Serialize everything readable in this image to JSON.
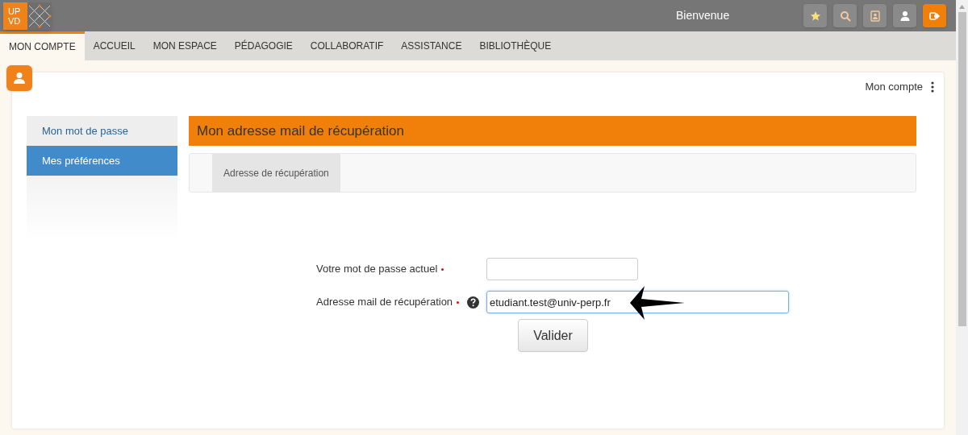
{
  "logo": {
    "line_1": "UP",
    "line_2": "VD"
  },
  "header": {
    "title": "Bienvenue"
  },
  "toolbar": [
    {
      "kind": "star"
    },
    {
      "kind": "search"
    },
    {
      "kind": "contacts"
    },
    {
      "kind": "user"
    },
    {
      "kind": "logout"
    }
  ],
  "tabs": [
    {
      "label": "MON COMPTE",
      "selected": true
    },
    {
      "label": "ACCUEIL",
      "selected": false
    },
    {
      "label": "MON ESPACE",
      "selected": false
    },
    {
      "label": "PÉDAGOGIE",
      "selected": false
    },
    {
      "label": "COLLABORATIF",
      "selected": false
    },
    {
      "label": "ASSISTANCE",
      "selected": false
    },
    {
      "label": "BIBLIOTHÈQUE",
      "selected": false
    }
  ],
  "breadcrumb": "Mon compte",
  "sidebar": {
    "items": [
      {
        "label": "Mon mot de passe",
        "selected": false
      },
      {
        "label": "Mes préférences",
        "selected": true
      }
    ]
  },
  "panel": {
    "title": "Mon adresse mail de récupération",
    "subtabs": [
      {
        "label": "Adresse de récupération",
        "selected": true
      }
    ]
  },
  "form": {
    "fields": [
      {
        "label": "Votre mot de passe actuel",
        "required": true,
        "help": false,
        "focused": false,
        "kind": "password"
      },
      {
        "label": "Adresse mail de récupération",
        "required": true,
        "help": true,
        "value": "etudiant.test@univ-perp.fr",
        "focused": true,
        "kind": "text"
      }
    ],
    "submit": "Valider"
  }
}
